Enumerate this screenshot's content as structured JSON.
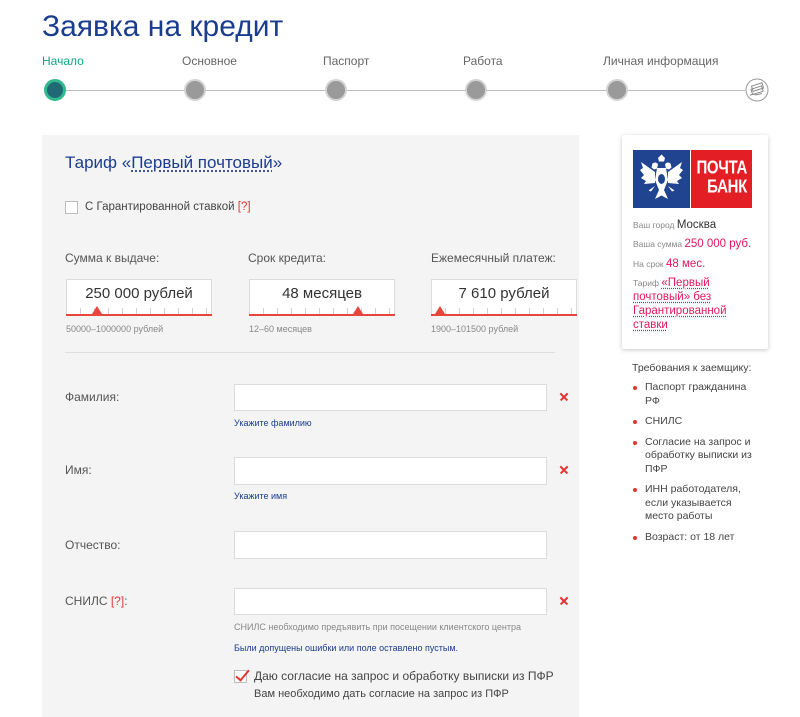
{
  "page": {
    "title": "Заявка на кредит"
  },
  "colors": {
    "brand_blue": "#1b3d8f",
    "step_active": "#17a286",
    "error_red": "#e3342f",
    "accent_pink": "#e2185b",
    "panel_bg": "#f4f4f4",
    "logo_blue": "#20448f",
    "logo_red": "#e31e24"
  },
  "icons": {
    "steps_end": "money-icon",
    "field_error": "close-icon",
    "consent_check": "checkmark-icon",
    "logo_emblem": "double-headed-eagle-icon",
    "list_bullet": "bullet-icon"
  },
  "steps": [
    {
      "label": "Начало",
      "active": true
    },
    {
      "label": "Основное",
      "active": false
    },
    {
      "label": "Паспорт",
      "active": false
    },
    {
      "label": "Работа",
      "active": false
    },
    {
      "label": "Личная информация",
      "active": false
    }
  ],
  "tariff": {
    "prefix": "Тариф «",
    "name": "Первый почтовый",
    "suffix": "»"
  },
  "guaranteed_rate": {
    "label": "С Гарантированной ставкой",
    "help": "[?]",
    "checked": false
  },
  "sliders": [
    {
      "label": "Сумма к выдаче:",
      "value_text": "250 000 рублей",
      "range_text": "50000–1000000 рублей",
      "min": 50000,
      "max": 1000000,
      "value": 250000
    },
    {
      "label": "Срок кредита:",
      "value_text": "48 месяцев",
      "range_text": "12–60 месяцев",
      "min": 12,
      "max": 60,
      "value": 48
    },
    {
      "label": "Ежемесячный платеж:",
      "value_text": "7 610 рублей",
      "range_text": "1900–101500 рублей",
      "min": 1900,
      "max": 101500,
      "value": 7610
    }
  ],
  "form": {
    "surname": {
      "label": "Фамилия:",
      "value": "",
      "hint": "Укажите фамилию"
    },
    "name": {
      "label": "Имя:",
      "value": "",
      "hint": "Укажите имя"
    },
    "patronymic": {
      "label": "Отчество:",
      "value": ""
    },
    "snils": {
      "label": "СНИЛС",
      "help": "[?]",
      "label_suffix": ":",
      "value": "",
      "note": "СНИЛС необходимо предъявить при посещении клиентского центра",
      "error": "Были допущены ошибки или поле оставлено пустым."
    },
    "consent": {
      "label": "Даю согласие на запрос и обработку выписки из ПФР",
      "note": "Вам необходимо дать согласие на запрос из ПФР",
      "checked": true
    }
  },
  "summary": {
    "logo_text": [
      "ПОЧТА",
      "БАНК"
    ],
    "city_label": "Ваш город",
    "city": "Москва",
    "amount_label": "Ваша сумма",
    "amount": "250 000 руб.",
    "term_label": "На срок",
    "term": "48 мес.",
    "tariff_label": "Тариф",
    "tariff": "«Первый почтовый» без Гарантированной ставки"
  },
  "requirements": {
    "title": "Требования к заемщику:",
    "items": [
      "Паспорт гражданина РФ",
      "СНИЛС",
      "Согласие на запрос и обработку выписки из ПФР",
      "ИНН работодателя, если указывается место работы",
      "Возраст: от 18 лет"
    ]
  }
}
